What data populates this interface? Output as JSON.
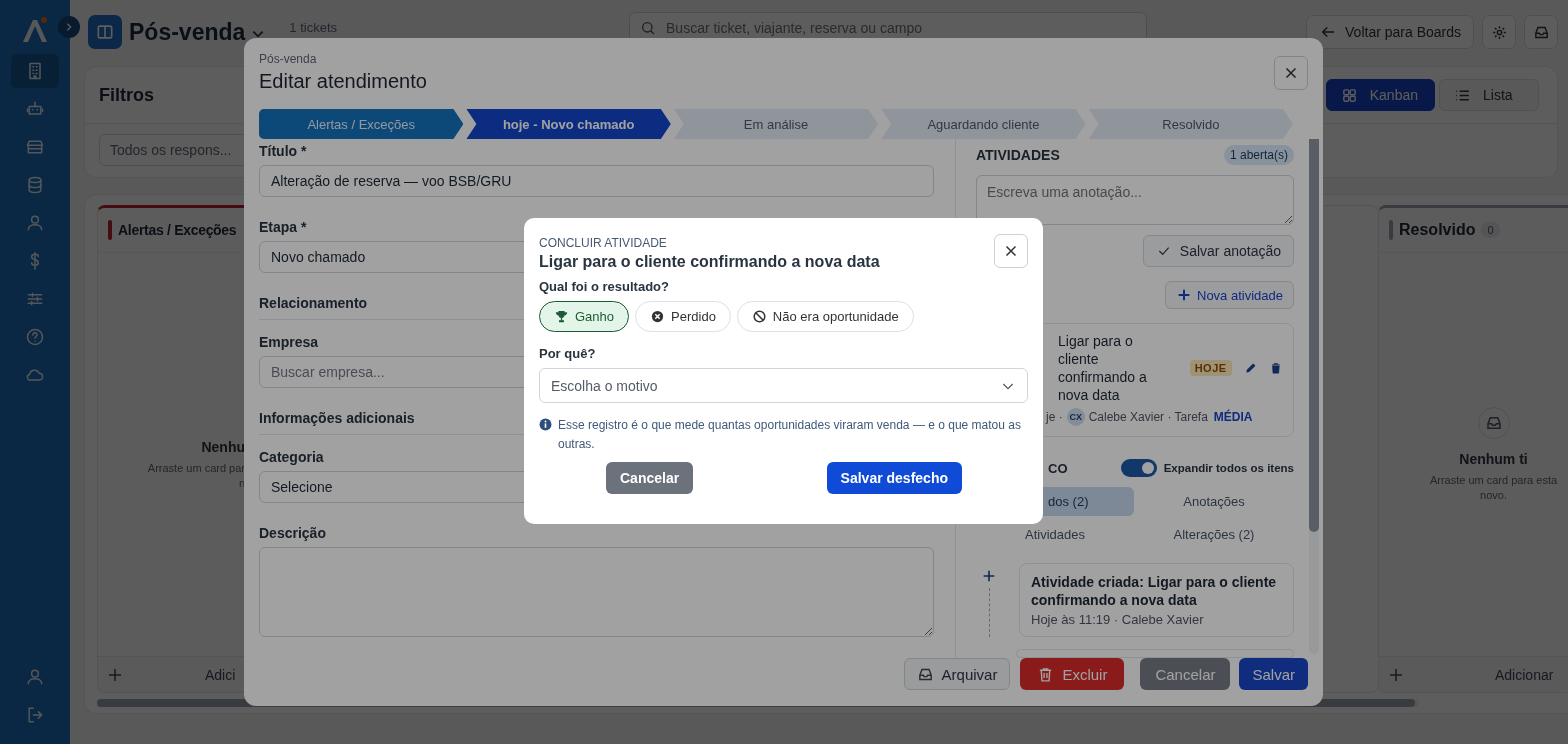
{
  "sidebar": {
    "nav": [
      {
        "selected": true
      },
      {
        "selected": false
      },
      {
        "selected": false
      },
      {
        "selected": false
      },
      {
        "selected": false
      },
      {
        "selected": false
      },
      {
        "selected": false
      },
      {
        "selected": false
      },
      {
        "selected": false
      }
    ]
  },
  "header": {
    "title": "Pós-venda",
    "count": "1 tickets",
    "search_placeholder": "Buscar ticket, viajante, reserva ou campo",
    "back_button": "Voltar para Boards"
  },
  "filters": {
    "title": "Filtros",
    "owner_select": "Todos os respons...",
    "views": [
      {
        "label": "Kanban",
        "selected": true
      },
      {
        "label": "Lista",
        "selected": false
      }
    ]
  },
  "board": {
    "columns": [
      {
        "title": "Alertas / Exceções",
        "kind": "alert",
        "empty_title": "Nenhu",
        "empty_text": [
          "Arraste um card par",
          "n"
        ],
        "add_label": "Adici"
      },
      {
        "title": "Resolvido",
        "count": "0",
        "kind": "neutral",
        "empty_title": "Nenhum ti",
        "empty_text": [
          "Arraste um card para esta",
          "novo."
        ],
        "add_label": "Adicionar"
      }
    ]
  },
  "edit_modal": {
    "breadcrumb": "Pós-venda",
    "title": "Editar atendimento",
    "steps": [
      {
        "label": "Alertas / Exceções",
        "done": true,
        "selected": false
      },
      {
        "label": "hoje - Novo chamado",
        "done": false,
        "selected": true
      },
      {
        "label": "Em análise",
        "done": false,
        "selected": false
      },
      {
        "label": "Aguardando cliente",
        "done": false,
        "selected": false
      },
      {
        "label": "Resolvido",
        "done": false,
        "selected": false
      }
    ],
    "form": [
      {
        "kind": "field",
        "label": "Título *",
        "value": "Alteração de reserva — voo BSB/GRU"
      },
      {
        "kind": "field",
        "label": "Etapa *",
        "value": "Novo chamado"
      },
      {
        "kind": "section",
        "label": "Relacionamento"
      },
      {
        "kind": "field",
        "label": "Empresa",
        "placeholder": "Buscar empresa..."
      },
      {
        "kind": "section",
        "label": "Informações adicionais"
      },
      {
        "kind": "field",
        "label": "Categoria",
        "value": "Selecione"
      },
      {
        "kind": "textarea",
        "label": "Descrição"
      }
    ],
    "activities": {
      "title": "ATIVIDADES",
      "badge": "1 aberta(s)",
      "note_placeholder": "Escreva uma anotação...",
      "save_note": "Salvar anotação",
      "new_activity": "Nova atividade",
      "items": [
        {
          "title": "Ligar para o cliente confirmando a nova data",
          "due": "HOJE",
          "date": "je ·",
          "avatar": "CX",
          "owner": "Calebe Xavier · Tarefa",
          "priority": "MÉDIA"
        }
      ]
    },
    "history": {
      "title": "CO",
      "toggle": {
        "label": "Expandir todos os itens",
        "on": true
      },
      "tabs": [
        {
          "label": "dos (2)",
          "selected": true
        },
        {
          "label": "Anotações",
          "selected": false
        },
        {
          "label": "Atividades",
          "selected": false
        },
        {
          "label": "Alterações (2)",
          "selected": false
        }
      ],
      "events": [
        {
          "title": "Atividade criada: Ligar para o cliente confirmando a nova data",
          "meta": "Hoje às 11:19 · Calebe Xavier"
        }
      ]
    },
    "footer": [
      {
        "kind": "archive",
        "label": "Arquivar"
      },
      {
        "kind": "delete",
        "label": "Excluir"
      },
      {
        "kind": "cancel",
        "label": "Cancelar"
      },
      {
        "kind": "save",
        "label": "Salvar"
      }
    ]
  },
  "outcome_modal": {
    "eyebrow": "CONCLUIR ATIVIDADE",
    "title": "Ligar para o cliente confirmando a nova data",
    "question": "Qual foi o resultado?",
    "options": [
      {
        "kind": "won",
        "label": "Ganho",
        "selected": true
      },
      {
        "kind": "lost",
        "label": "Perdido",
        "selected": false
      },
      {
        "kind": "none",
        "label": "Não era oportunidade",
        "selected": false
      }
    ],
    "reason_label": "Por quê?",
    "reason_placeholder": "Escolha o motivo",
    "info": "Esse registro é o que mede quantas oportunidades viraram venda — e o que matou as outras.",
    "cancel": "Cancelar",
    "submit": "Salvar desfecho"
  }
}
